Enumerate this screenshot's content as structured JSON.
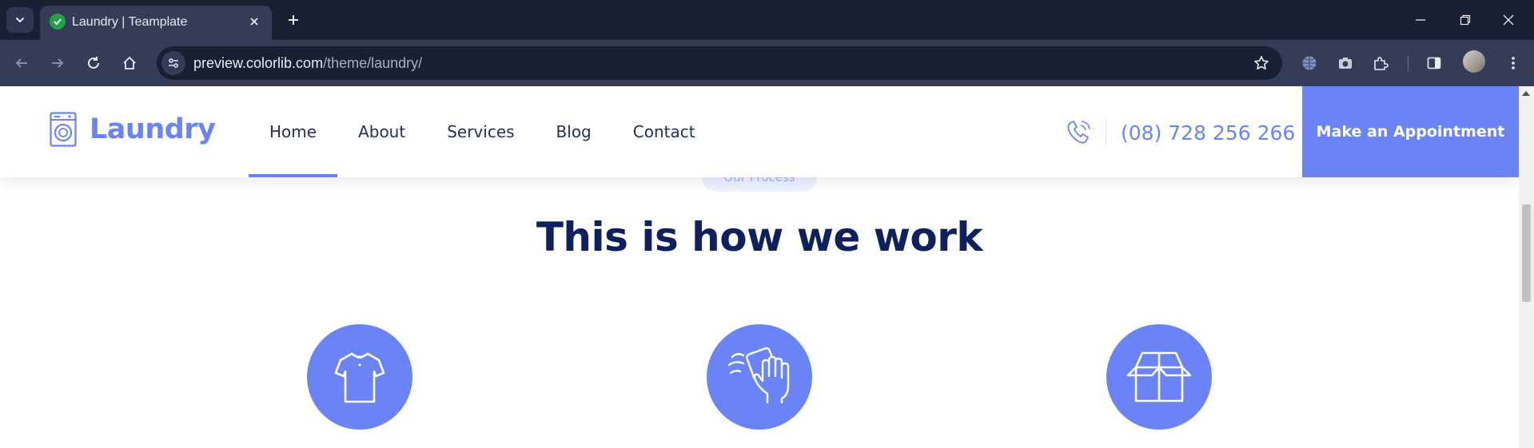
{
  "browser": {
    "tab": {
      "title": "Laundry | Teamplate"
    },
    "url": {
      "host": "preview.colorlib.com",
      "path": "/theme/laundry/"
    }
  },
  "site": {
    "logo": {
      "text": "Laundry"
    },
    "nav": [
      {
        "label": "Home",
        "active": true
      },
      {
        "label": "About"
      },
      {
        "label": "Services"
      },
      {
        "label": "Blog"
      },
      {
        "label": "Contact"
      }
    ],
    "phone": "(08) 728 256 266",
    "cta_label": "Make an Appointment"
  },
  "process": {
    "pill": "Our Process",
    "title": "This is how we work",
    "steps": [
      {
        "icon": "t-shirt-icon"
      },
      {
        "icon": "hand-washing-icon"
      },
      {
        "icon": "open-box-icon"
      }
    ]
  },
  "colors": {
    "accent": "#6b84f5",
    "heading": "#0f2060",
    "chrome_dark": "#1b1f33",
    "chrome_toolbar": "#363c58"
  }
}
